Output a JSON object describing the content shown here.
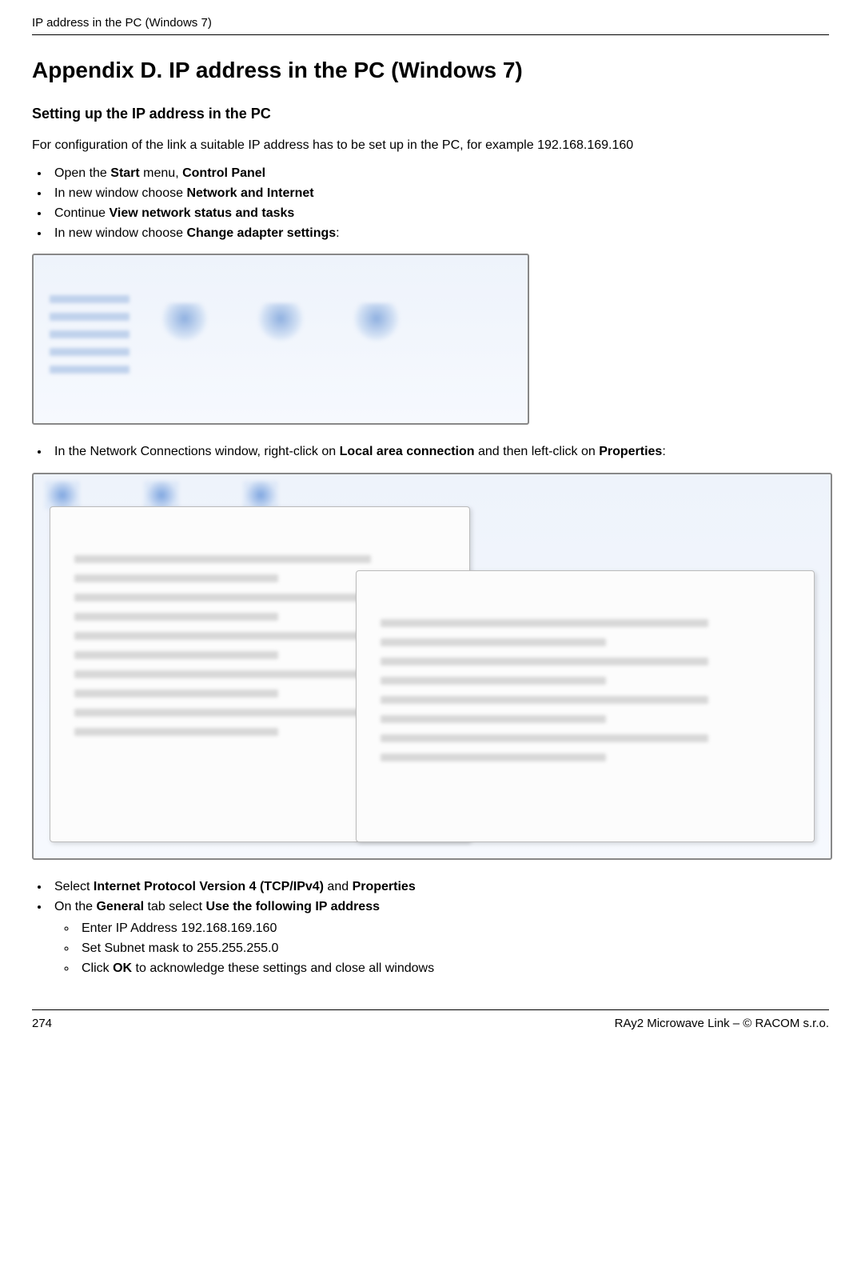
{
  "runningHeader": "IP address in the PC (Windows 7)",
  "title": "Appendix D. IP address in the PC (Windows 7)",
  "subheading": "Setting up the IP address in the PC",
  "intro": "For configuration of the link a suitable IP address has to be set up in the PC, for example 192.168.169.160",
  "steps": {
    "s1_pre": "Open the ",
    "s1_b1": "Start",
    "s1_mid": " menu, ",
    "s1_b2": "Control Panel",
    "s2_pre": "In new window choose ",
    "s2_b": "Network and Internet",
    "s3_pre": "Continue ",
    "s3_b": "View network status and tasks",
    "s4_pre": "In new window choose ",
    "s4_b": "Change adapter settings",
    "s4_post": ":",
    "s5_pre": "In the Network Connections window, right-click on ",
    "s5_b1": "Local area connection",
    "s5_mid": " and then left-click on ",
    "s5_b2": "Properties",
    "s5_post": ":",
    "s6_pre": "Select ",
    "s6_b1": "Internet Protocol Version 4 (TCP/IPv4)",
    "s6_mid": " and ",
    "s6_b2": "Properties",
    "s7_pre": "On the ",
    "s7_b1": "General",
    "s7_mid": " tab select ",
    "s7_b2": "Use the following IP address",
    "sub1": "Enter IP Address 192.168.169.160",
    "sub2": "Set Subnet mask to 255.255.255.0",
    "sub3_pre": "Click ",
    "sub3_b": "OK",
    "sub3_post": " to acknowledge these settings and close all windows"
  },
  "footer": {
    "page": "274",
    "right": "RAy2 Microwave Link – © RACOM s.r.o."
  }
}
